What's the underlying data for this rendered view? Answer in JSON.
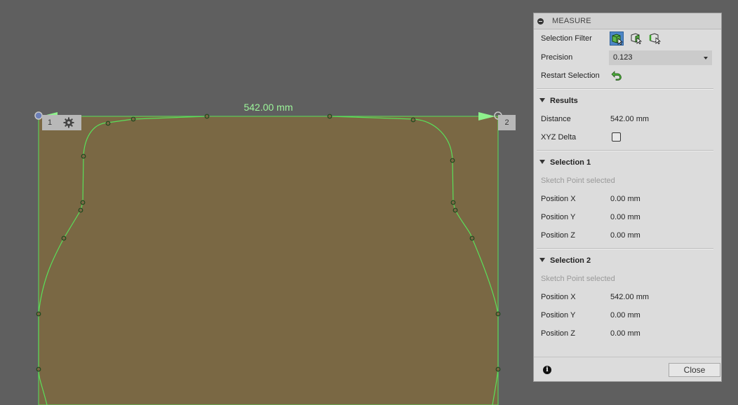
{
  "viewport": {
    "dimension_label": "542.00 mm",
    "point1_label": "1",
    "point2_label": "2",
    "colors": {
      "sketch": "#5ae05a",
      "body_fill": "#7a6844",
      "background": "#5f5f5f"
    }
  },
  "measure": {
    "title": "MEASURE",
    "selection_filter": {
      "label": "Selection Filter",
      "icons": [
        "body-filter-icon",
        "face-filter-icon",
        "edge-filter-icon"
      ],
      "active_index": 0
    },
    "precision": {
      "label": "Precision",
      "value": "0.123"
    },
    "restart_selection": {
      "label": "Restart Selection",
      "icon": "restart-icon"
    },
    "results": {
      "title": "Results",
      "distance_label": "Distance",
      "distance_value": "542.00 mm",
      "xyz_delta_label": "XYZ Delta",
      "xyz_delta_checked": false
    },
    "selection1": {
      "title": "Selection 1",
      "status": "Sketch Point selected",
      "x_label": "Position X",
      "x_value": "0.00 mm",
      "y_label": "Position Y",
      "y_value": "0.00 mm",
      "z_label": "Position Z",
      "z_value": "0.00 mm"
    },
    "selection2": {
      "title": "Selection 2",
      "status": "Sketch Point selected",
      "x_label": "Position X",
      "x_value": "542.00 mm",
      "y_label": "Position Y",
      "y_value": "0.00 mm",
      "z_label": "Position Z",
      "z_value": "0.00 mm"
    },
    "close_label": "Close",
    "info_icon": "info-icon"
  }
}
